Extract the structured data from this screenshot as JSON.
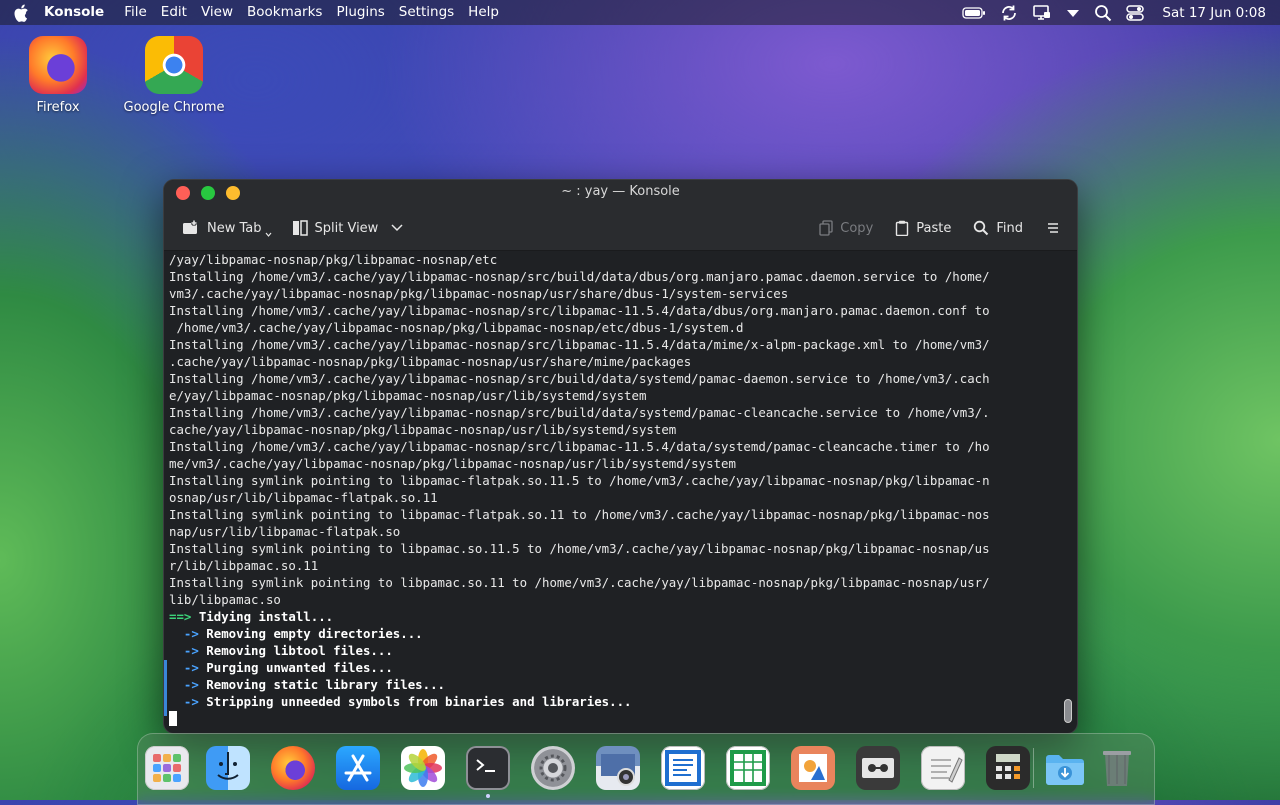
{
  "menubar": {
    "app_name": "Konsole",
    "menus": [
      "File",
      "Edit",
      "View",
      "Bookmarks",
      "Plugins",
      "Settings",
      "Help"
    ],
    "clock": "Sat 17 Jun 0:08"
  },
  "desktop": {
    "icons": [
      {
        "label": "Firefox",
        "icon": "firefox-icon"
      },
      {
        "label": "Google Chrome",
        "icon": "chrome-icon"
      }
    ]
  },
  "window": {
    "title": "~ : yay — Konsole",
    "toolbar": {
      "new_tab": "New Tab",
      "split_view": "Split View",
      "copy": "Copy",
      "paste": "Paste",
      "find": "Find"
    },
    "terminal_lines": [
      {
        "t": "/yay/libpamac-nosnap/pkg/libpamac-nosnap/etc"
      },
      {
        "t": "Installing /home/vm3/.cache/yay/libpamac-nosnap/src/build/data/dbus/org.manjaro.pamac.daemon.service to /home/"
      },
      {
        "t": "vm3/.cache/yay/libpamac-nosnap/pkg/libpamac-nosnap/usr/share/dbus-1/system-services"
      },
      {
        "t": "Installing /home/vm3/.cache/yay/libpamac-nosnap/src/libpamac-11.5.4/data/dbus/org.manjaro.pamac.daemon.conf to"
      },
      {
        "t": " /home/vm3/.cache/yay/libpamac-nosnap/pkg/libpamac-nosnap/etc/dbus-1/system.d"
      },
      {
        "t": "Installing /home/vm3/.cache/yay/libpamac-nosnap/src/libpamac-11.5.4/data/mime/x-alpm-package.xml to /home/vm3/"
      },
      {
        "t": ".cache/yay/libpamac-nosnap/pkg/libpamac-nosnap/usr/share/mime/packages"
      },
      {
        "t": "Installing /home/vm3/.cache/yay/libpamac-nosnap/src/build/data/systemd/pamac-daemon.service to /home/vm3/.cach"
      },
      {
        "t": "e/yay/libpamac-nosnap/pkg/libpamac-nosnap/usr/lib/systemd/system"
      },
      {
        "t": "Installing /home/vm3/.cache/yay/libpamac-nosnap/src/build/data/systemd/pamac-cleancache.service to /home/vm3/."
      },
      {
        "t": "cache/yay/libpamac-nosnap/pkg/libpamac-nosnap/usr/lib/systemd/system"
      },
      {
        "t": "Installing /home/vm3/.cache/yay/libpamac-nosnap/src/libpamac-11.5.4/data/systemd/pamac-cleancache.timer to /ho"
      },
      {
        "t": "me/vm3/.cache/yay/libpamac-nosnap/pkg/libpamac-nosnap/usr/lib/systemd/system"
      },
      {
        "t": "Installing symlink pointing to libpamac-flatpak.so.11.5 to /home/vm3/.cache/yay/libpamac-nosnap/pkg/libpamac-n"
      },
      {
        "t": "osnap/usr/lib/libpamac-flatpak.so.11"
      },
      {
        "t": "Installing symlink pointing to libpamac-flatpak.so.11 to /home/vm3/.cache/yay/libpamac-nosnap/pkg/libpamac-nos"
      },
      {
        "t": "nap/usr/lib/libpamac-flatpak.so"
      },
      {
        "t": "Installing symlink pointing to libpamac.so.11.5 to /home/vm3/.cache/yay/libpamac-nosnap/pkg/libpamac-nosnap/us"
      },
      {
        "t": "r/lib/libpamac.so.11"
      },
      {
        "t": "Installing symlink pointing to libpamac.so.11 to /home/vm3/.cache/yay/libpamac-nosnap/pkg/libpamac-nosnap/usr/"
      },
      {
        "t": "lib/libpamac.so"
      },
      {
        "p": "==>",
        "pc": "g",
        "t": " Tidying install..."
      },
      {
        "p": "  ->",
        "pc": "b",
        "t": " Removing empty directories..."
      },
      {
        "p": "  ->",
        "pc": "b",
        "t": " Removing libtool files..."
      },
      {
        "p": "  ->",
        "pc": "b",
        "t": " Purging unwanted files..."
      },
      {
        "p": "  ->",
        "pc": "b",
        "t": " Removing static library files..."
      },
      {
        "p": "  ->",
        "pc": "b",
        "t": " Stripping unneeded symbols from binaries and libraries..."
      }
    ]
  },
  "dock": {
    "items": [
      "launcher-icon",
      "finder-icon",
      "firefox-icon",
      "app-store-icon",
      "photos-icon",
      "terminal-icon",
      "settings-icon",
      "screenshot-icon",
      "writer-icon",
      "calc-spreadsheet-icon",
      "draw-icon",
      "tape-recorder-icon",
      "text-editor-icon",
      "calculator-icon",
      "downloads-folder-icon",
      "trash-icon"
    ]
  },
  "colors": {
    "accent": "#3a86d8",
    "prompt_green": "#3cd47a",
    "prompt_blue": "#4aa3ff"
  }
}
